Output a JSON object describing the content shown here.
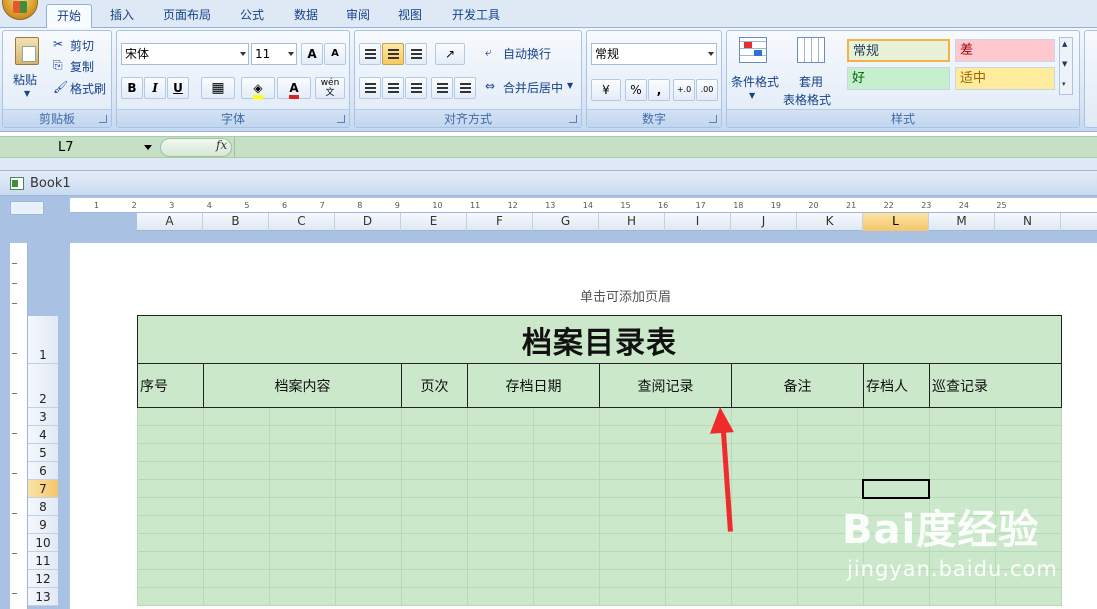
{
  "ribbon": {
    "tabs": [
      "开始",
      "插入",
      "页面布局",
      "公式",
      "数据",
      "审阅",
      "视图",
      "开发工具"
    ],
    "clipboard": {
      "paste": "粘贴",
      "cut": "剪切",
      "copy": "复制",
      "format_painter": "格式刷",
      "label": "剪贴板"
    },
    "font": {
      "name": "宋体",
      "size": "11",
      "grow": "A",
      "shrink": "A",
      "bold": "B",
      "italic": "I",
      "underline": "U",
      "phonetic": "wén",
      "phonetic_char": "文",
      "label": "字体"
    },
    "alignment": {
      "wrap": "自动换行",
      "merge": "合并后居中",
      "label": "对齐方式"
    },
    "number": {
      "format": "常规",
      "percent": "%",
      "comma": ",",
      "inc_decimal": "+.0",
      "dec_decimal": ".00",
      "label": "数字"
    },
    "styles": {
      "conditional": "条件格式",
      "table_format_1": "套用",
      "table_format_2": "表格格式",
      "normal": "常规",
      "bad": "差",
      "good": "好",
      "neutral": "适中",
      "label": "样式",
      "colors": {
        "normal": "#e8f2d8",
        "bad": "#ffc7ce",
        "good": "#c6efce",
        "neutral": "#ffeb9c"
      }
    }
  },
  "formula_bar": {
    "name_box": "L7",
    "fx": "fx",
    "value": ""
  },
  "workbook": {
    "title": "Book1"
  },
  "ruler_marks": [
    "1",
    "2",
    "3",
    "4",
    "5",
    "6",
    "7",
    "8",
    "9",
    "10",
    "11",
    "12",
    "13",
    "14",
    "15",
    "16",
    "17",
    "18",
    "19",
    "20",
    "21",
    "22",
    "23",
    "24",
    "25"
  ],
  "columns": [
    "A",
    "B",
    "C",
    "D",
    "E",
    "F",
    "G",
    "H",
    "I",
    "J",
    "K",
    "L",
    "M",
    "N"
  ],
  "active_column": "L",
  "rows": [
    "1",
    "2",
    "3",
    "4",
    "5",
    "6",
    "7",
    "8",
    "9",
    "10",
    "11",
    "12",
    "13"
  ],
  "active_row": "7",
  "page": {
    "header_hint": "单击可添加页眉"
  },
  "table": {
    "title": "档案目录表",
    "headers": [
      "序号",
      "档案内容",
      "页次",
      "存档日期",
      "查阅记录",
      "备注",
      "存档人",
      "巡查记录"
    ]
  },
  "watermark": {
    "logo": "Bai度经验",
    "url": "jingyan.baidu.com"
  }
}
